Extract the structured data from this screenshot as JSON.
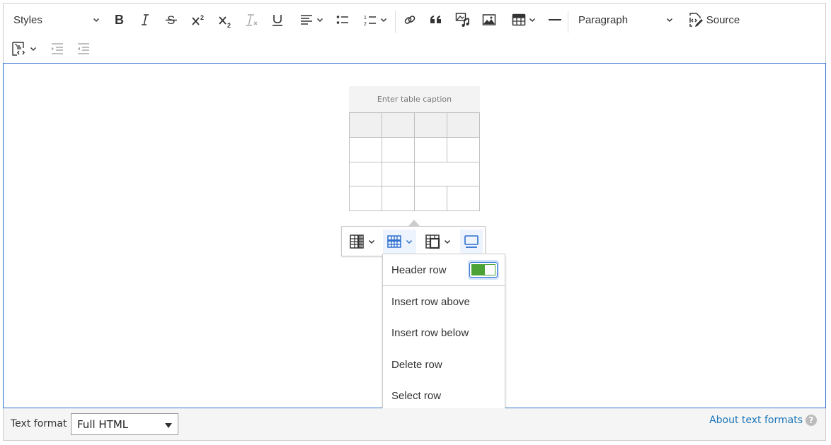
{
  "toolbar": {
    "styles_label": "Styles",
    "heading_label": "Paragraph",
    "source_label": "Source",
    "buttons": [
      {
        "name": "bold",
        "icon": "bold-icon"
      },
      {
        "name": "italic",
        "icon": "italic-icon"
      },
      {
        "name": "strikethrough",
        "icon": "strikethrough-icon"
      },
      {
        "name": "superscript",
        "icon": "superscript-icon"
      },
      {
        "name": "subscript",
        "icon": "subscript-icon"
      },
      {
        "name": "remove-format",
        "icon": "remove-format-icon",
        "disabled": true
      },
      {
        "name": "underline",
        "icon": "underline-icon"
      },
      {
        "name": "alignment",
        "icon": "align-left-icon"
      },
      {
        "name": "bulleted-list",
        "icon": "bulleted-list-icon"
      },
      {
        "name": "numbered-list",
        "icon": "numbered-list-icon"
      },
      {
        "name": "link",
        "icon": "link-icon"
      },
      {
        "name": "block-quote",
        "icon": "quote-icon"
      },
      {
        "name": "media-embed",
        "icon": "media-icon"
      },
      {
        "name": "image",
        "icon": "image-icon"
      },
      {
        "name": "insert-table",
        "icon": "table-icon"
      },
      {
        "name": "horizontal-line",
        "icon": "horizontal-line-icon"
      },
      {
        "name": "code-block",
        "icon": "code-block-icon"
      },
      {
        "name": "indent",
        "icon": "indent-icon",
        "disabled": true
      },
      {
        "name": "outdent",
        "icon": "outdent-icon",
        "disabled": true
      }
    ]
  },
  "editor": {
    "table": {
      "caption_placeholder": "Enter table caption",
      "rows": 4,
      "columns": 4,
      "header_rows": 1
    }
  },
  "table_toolbar": {
    "buttons": [
      {
        "name": "table-column",
        "icon": "table-column-icon"
      },
      {
        "name": "table-row",
        "icon": "table-row-icon",
        "active": true
      },
      {
        "name": "merge-cells",
        "icon": "merge-cells-icon"
      },
      {
        "name": "table-properties",
        "icon": "table-properties-icon",
        "active": true
      }
    ]
  },
  "row_menu": {
    "header_row_label": "Header row",
    "header_row_on": true,
    "items": [
      {
        "label": "Insert row above"
      },
      {
        "label": "Insert row below"
      },
      {
        "label": "Delete row"
      },
      {
        "label": "Select row"
      }
    ]
  },
  "footer": {
    "text_format_label": "Text format",
    "text_format_value": "Full HTML",
    "about_link": "About text formats",
    "help_icon": "?"
  },
  "colors": {
    "focus_border": "#2f6fd0",
    "toggle_on": "#4da237",
    "link": "#1a74b8",
    "active_bg": "#eef4fd"
  }
}
